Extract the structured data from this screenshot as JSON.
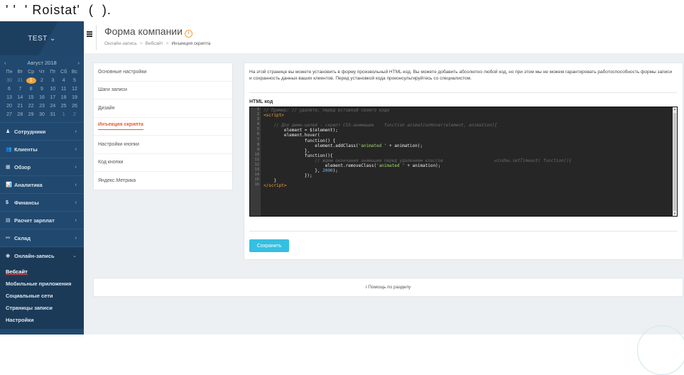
{
  "top_caption": [
    "' '",
    "' Roistat'",
    "(",
    ")."
  ],
  "sidebar": {
    "account": "TEST ⌄",
    "calendar": {
      "month": "Август 2018",
      "prev": "‹",
      "next": "›",
      "weekdays": [
        "Пн",
        "Вт",
        "Ср",
        "Чт",
        "Пт",
        "Сб",
        "Вс"
      ],
      "rows": [
        [
          "30",
          "31",
          "1",
          "2",
          "3",
          "4",
          "5"
        ],
        [
          "6",
          "7",
          "8",
          "9",
          "10",
          "11",
          "12"
        ],
        [
          "13",
          "14",
          "15",
          "16",
          "17",
          "18",
          "19"
        ],
        [
          "20",
          "21",
          "22",
          "23",
          "24",
          "25",
          "26"
        ],
        [
          "27",
          "28",
          "29",
          "30",
          "31",
          "1",
          "2"
        ]
      ]
    },
    "nav": [
      {
        "icon": "♟",
        "label": "Сотрудники"
      },
      {
        "icon": "👥",
        "label": "Клиенты"
      },
      {
        "icon": "▦",
        "label": "Обзор"
      },
      {
        "icon": "📊",
        "label": "Аналитика"
      },
      {
        "icon": "$",
        "label": "Финансы"
      },
      {
        "icon": "▤",
        "label": "Расчет зарплат"
      },
      {
        "icon": "⚯",
        "label": "Склад"
      },
      {
        "icon": "◉",
        "label": "Онлайн-запись"
      }
    ],
    "subnav": [
      "Вебсайт",
      "Мобильные приложения",
      "Социальные сети",
      "Страницы записи",
      "Настройки"
    ]
  },
  "header": {
    "title": "Форма компании",
    "info": "i",
    "breadcrumbs": [
      "Онлайн-запись",
      "Вебсайт",
      "Инъекция скрипта"
    ]
  },
  "settings_menu": [
    "Основные настройки",
    "Шаги записи",
    "Дизайн",
    "Инъекция скрипта",
    "Настройки кнопки",
    "Код кнопки",
    "Яндекс.Метрика"
  ],
  "content": {
    "description": "На этой странице вы можете установить в форму произвольный HTML-код. Вы можете добавить абсолютно любой код, но при этом мы не можем гарантировать работоспособность формы записи и сохранность данных ваших клиентов. Перед установкой кода проконсультируйтесь со специалистом.",
    "code_label": "HTML код",
    "line_numbers": [
      "1",
      "2",
      "3",
      "4",
      "5",
      "6",
      "7",
      "8",
      "9",
      "10",
      "11",
      "12",
      "13",
      "14",
      "15",
      "16"
    ],
    "save_label": "Сохранить"
  },
  "help": {
    "icon": "i",
    "label": "Помощь по разделу"
  }
}
